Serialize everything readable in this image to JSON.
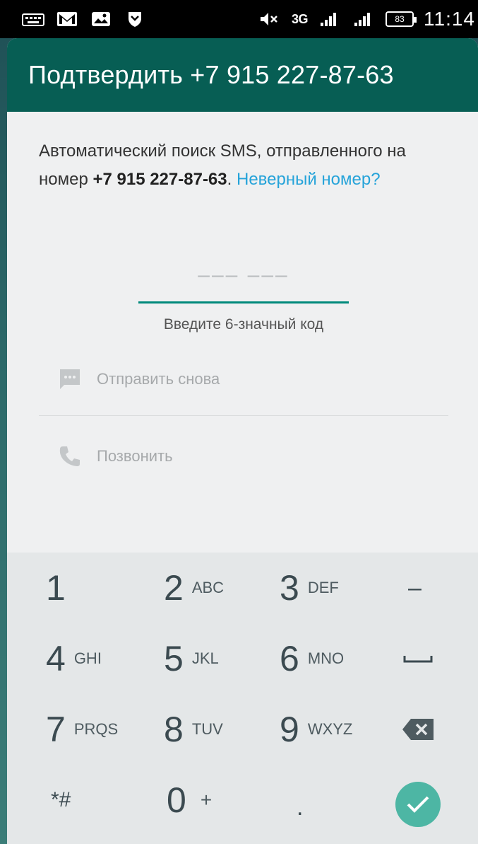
{
  "status_bar": {
    "network_label": "3G",
    "battery_level": "83",
    "time": "11:14"
  },
  "appbar": {
    "title": "Подтвердить +7 915 227-87-63"
  },
  "description": {
    "text_before": "Автоматический поиск SMS, отправленного на номер ",
    "phone": "+7 915 227-87-63",
    "text_after": ". ",
    "wrong_number_link": "Неверный номер?"
  },
  "code_input": {
    "placeholder": "––– –––",
    "hint": "Введите 6-значный код"
  },
  "options": {
    "resend_label": "Отправить снова",
    "call_label": "Позвонить"
  },
  "keypad": {
    "keys": [
      {
        "digit": "1",
        "letters": ""
      },
      {
        "digit": "2",
        "letters": "ABC"
      },
      {
        "digit": "3",
        "letters": "DEF"
      },
      {
        "digit": "4",
        "letters": "GHI"
      },
      {
        "digit": "5",
        "letters": "JKL"
      },
      {
        "digit": "6",
        "letters": "MNO"
      },
      {
        "digit": "7",
        "letters": "PRQS"
      },
      {
        "digit": "8",
        "letters": "TUV"
      },
      {
        "digit": "9",
        "letters": "WXYZ"
      },
      {
        "digit": "*#",
        "letters": ""
      },
      {
        "digit": "0",
        "letters": "+"
      },
      {
        "digit": ".",
        "letters": ""
      }
    ],
    "minus_key": "–",
    "icons": {
      "space": "space-icon",
      "backspace": "backspace-icon",
      "done": "check-icon"
    }
  },
  "colors": {
    "appbar": "#075e54",
    "accent": "#00897b",
    "link": "#25a3d9",
    "done_button": "#4db6a4"
  }
}
